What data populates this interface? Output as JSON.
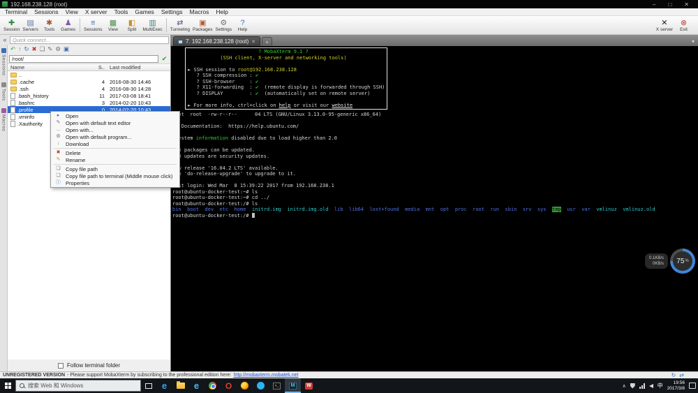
{
  "window": {
    "title": "192.168.238.128 (root)",
    "controls": [
      "minimize",
      "maximize",
      "close"
    ]
  },
  "menu": {
    "items": [
      "Terminal",
      "Sessions",
      "View",
      "X server",
      "Tools",
      "Games",
      "Settings",
      "Macros",
      "Help"
    ]
  },
  "toolbar": {
    "buttons": [
      {
        "label": "Session",
        "icon": "session-icon",
        "color": "#2f8c3f"
      },
      {
        "label": "Servers",
        "icon": "servers-icon",
        "color": "#5a78a8"
      },
      {
        "label": "Tools",
        "icon": "tools-icon",
        "color": "#a05a2c"
      },
      {
        "label": "Games",
        "icon": "games-icon",
        "color": "#7d5ba6"
      },
      {
        "label": "Sessions",
        "icon": "sessions-icon",
        "color": "#3b6fb5"
      },
      {
        "label": "View",
        "icon": "view-icon",
        "color": "#4a8f4a"
      },
      {
        "label": "Split",
        "icon": "split-icon",
        "color": "#c78f2e"
      },
      {
        "label": "MultiExec",
        "icon": "multiexec-icon",
        "color": "#3f7f7f"
      },
      {
        "label": "Tunneling",
        "icon": "tunneling-icon",
        "color": "#555588"
      },
      {
        "label": "Packages",
        "icon": "packages-icon",
        "color": "#b06030"
      },
      {
        "label": "Settings",
        "icon": "settings-icon",
        "color": "#707070"
      },
      {
        "label": "Help",
        "icon": "help-icon",
        "color": "#2e6fc0"
      }
    ],
    "right_buttons": [
      {
        "label": "X server",
        "icon": "xserver-icon",
        "color": "#222222"
      },
      {
        "label": "Exit",
        "icon": "exit-icon",
        "color": "#c23a2f"
      }
    ]
  },
  "quick_connect": {
    "placeholder": "Quick connect..."
  },
  "side_tabs": [
    {
      "label": "Sessions",
      "icon": "sessions-tab-icon",
      "color": "#3b6fb5"
    },
    {
      "label": "Tools",
      "icon": "tools-tab-icon",
      "color": "#8a8a8a"
    },
    {
      "label": "Macros",
      "icon": "macros-tab-icon",
      "color": "#a05aa0"
    }
  ],
  "file_panel": {
    "toolbar_icons": [
      {
        "name": "back-icon",
        "color": "#3f9d3f"
      },
      {
        "name": "up-icon",
        "color": "#3f9d3f"
      },
      {
        "name": "refresh-icon",
        "color": "#2e6fc0"
      },
      {
        "name": "stop-icon",
        "color": "#c23a2f"
      },
      {
        "name": "copy-icon",
        "color": "#707070"
      },
      {
        "name": "edit-icon",
        "color": "#707070"
      },
      {
        "name": "settings2-icon",
        "color": "#707070"
      },
      {
        "name": "monitor-icon",
        "color": "#3b6fb5"
      }
    ],
    "path": "/root/",
    "columns": {
      "name": "Name",
      "size": "S..",
      "modified": "Last modified"
    },
    "rows": [
      {
        "name": "..",
        "icon": "folder-up",
        "size": "",
        "modified": ""
      },
      {
        "name": ".cache",
        "icon": "folder",
        "size": "4",
        "modified": "2016-08-30 14:46"
      },
      {
        "name": ".ssh",
        "icon": "folder",
        "size": "4",
        "modified": "2016-08-30 14:28"
      },
      {
        "name": ".bash_history",
        "icon": "file",
        "size": "11",
        "modified": "2017-03-08 18:41"
      },
      {
        "name": ".bashrc",
        "icon": "file",
        "size": "3",
        "modified": "2014-02-20 10:43"
      },
      {
        "name": ".profile",
        "icon": "file",
        "size": "0",
        "modified": "2014-02-20 10:43",
        "selected": true
      },
      {
        "name": ".vminfo",
        "icon": "file",
        "size": "",
        "modified": ""
      },
      {
        "name": ".Xauthority",
        "icon": "file",
        "size": "",
        "modified": ""
      }
    ],
    "follow_label": "Follow terminal folder"
  },
  "context_menu": {
    "items": [
      {
        "label": "Open",
        "icon": "open-icon",
        "icon_color": "#3b6fb5"
      },
      {
        "label": "Open with default text editor",
        "icon": "editor-icon",
        "icon_color": "#707070"
      },
      {
        "label": "Open with...",
        "icon": "openwith-icon",
        "icon_color": "#707070"
      },
      {
        "label": "Open with default program...",
        "icon": "program-icon",
        "icon_color": "#707070"
      },
      {
        "label": "Download",
        "icon": "download-icon",
        "icon_color": "#3f9d3f"
      },
      {
        "separator": true
      },
      {
        "label": "Delete",
        "icon": "delete-icon",
        "icon_color": "#c23a2f"
      },
      {
        "label": "Rename",
        "icon": "rename-icon",
        "icon_color": "#c78f2e"
      },
      {
        "separator": true
      },
      {
        "label": "Copy file path",
        "icon": "copypath-icon",
        "icon_color": "#707070"
      },
      {
        "label": "Copy file path to terminal (Middle mouse click)",
        "icon": "copyterm-icon",
        "icon_color": "#707070"
      },
      {
        "label": "Properties",
        "icon": "properties-icon",
        "icon_color": "#2e6fc0"
      }
    ]
  },
  "terminal": {
    "tab_title": "7. 192.168.238.128 (root)",
    "banner": {
      "rows": [
        [
          {
            "t": "                        "
          },
          {
            "t": "? MobaXterm 9.1 ?",
            "c": "g"
          }
        ],
        [
          {
            "t": "           "
          },
          {
            "t": "(SSH client, X-server and networking tools)",
            "c": "y"
          }
        ],
        [],
        [
          {
            "t": "► SSH session to "
          },
          {
            "t": "root@192.168.238.128",
            "c": "y"
          }
        ],
        [
          {
            "t": "   ? SSH compression : "
          },
          {
            "t": "✔",
            "c": "g"
          }
        ],
        [
          {
            "t": "   ? SSH-browser     : "
          },
          {
            "t": "✔",
            "c": "g"
          }
        ],
        [
          {
            "t": "   ? X11-forwarding  : "
          },
          {
            "t": "✔",
            "c": "g"
          },
          {
            "t": "  (remote display is forwarded through SSH)"
          }
        ],
        [
          {
            "t": "   ? DISPLAY         : "
          },
          {
            "t": "✔",
            "c": "g"
          },
          {
            "t": "  (automatically set on remote server)"
          }
        ],
        [],
        [
          {
            "t": "► For more info, ctrl+click on "
          },
          {
            "t": "help",
            "c": "u"
          },
          {
            "t": " or visit our "
          },
          {
            "t": "website",
            "c": "u"
          }
        ]
      ]
    },
    "lines": [
      [
        {
          "t": "root  root  -rw-r--r--      04 LTS (GNU/Linux 3.13.0-95-generic x86_64)"
        }
      ],
      [],
      [
        {
          "t": " * Documentation:  https://help.ubuntu.com/"
        }
      ],
      [],
      [
        {
          "t": " System "
        },
        {
          "t": "information",
          "c": "g"
        },
        {
          "t": " disabled due to load higher than 2.0"
        }
      ],
      [],
      [
        {
          "t": "225 packages can be updated."
        }
      ],
      [
        {
          "t": "123 updates are security updates."
        }
      ],
      [],
      [
        {
          "t": "New release '16.04.2 LTS' available."
        }
      ],
      [
        {
          "t": "Run 'do-release-upgrade' to upgrade to it."
        }
      ],
      [],
      [
        {
          "t": "Last login: Wed Mar  8 15:39:22 2017 from 192.168.238.1"
        }
      ],
      [
        {
          "t": "root@ubuntu-docker-test:~# ls"
        }
      ],
      [
        {
          "t": "root@ubuntu-docker-test:~# cd ../"
        }
      ],
      [
        {
          "t": "root@ubuntu-docker-test:/# ls"
        }
      ],
      [
        {
          "t": "bin",
          "c": "b"
        },
        {
          "t": "  "
        },
        {
          "t": "boot",
          "c": "b"
        },
        {
          "t": "  "
        },
        {
          "t": "dev",
          "c": "b"
        },
        {
          "t": "  "
        },
        {
          "t": "etc",
          "c": "b"
        },
        {
          "t": "  "
        },
        {
          "t": "home",
          "c": "b"
        },
        {
          "t": "  "
        },
        {
          "t": "initrd.img",
          "c": "c"
        },
        {
          "t": "  "
        },
        {
          "t": "initrd.img.old",
          "c": "c"
        },
        {
          "t": "  "
        },
        {
          "t": "lib",
          "c": "b"
        },
        {
          "t": "  "
        },
        {
          "t": "lib64",
          "c": "b"
        },
        {
          "t": "  "
        },
        {
          "t": "lost+found",
          "c": "b"
        },
        {
          "t": "  "
        },
        {
          "t": "media",
          "c": "b"
        },
        {
          "t": "  "
        },
        {
          "t": "mnt",
          "c": "b"
        },
        {
          "t": "  "
        },
        {
          "t": "opt",
          "c": "b"
        },
        {
          "t": "  "
        },
        {
          "t": "proc",
          "c": "b"
        },
        {
          "t": "  "
        },
        {
          "t": "root",
          "c": "b"
        },
        {
          "t": "  "
        },
        {
          "t": "run",
          "c": "b"
        },
        {
          "t": "  "
        },
        {
          "t": "sbin",
          "c": "b"
        },
        {
          "t": "  "
        },
        {
          "t": "srv",
          "c": "b"
        },
        {
          "t": "  "
        },
        {
          "t": "sys",
          "c": "b"
        },
        {
          "t": "  "
        },
        {
          "t": "tmp",
          "c": "tmp"
        },
        {
          "t": "  "
        },
        {
          "t": "usr",
          "c": "b"
        },
        {
          "t": "  "
        },
        {
          "t": "var",
          "c": "b"
        },
        {
          "t": "  "
        },
        {
          "t": "vmlinuz",
          "c": "c"
        },
        {
          "t": "  "
        },
        {
          "t": "vmlinuz.old",
          "c": "c"
        }
      ],
      [
        {
          "t": "root@ubuntu-docker-test:/# "
        },
        {
          "cursor": true
        }
      ]
    ]
  },
  "net_widget": {
    "up": "0.1KB/s",
    "down": "0KB/s",
    "percent": "75",
    "unit": "%"
  },
  "status_bar": {
    "bold": "UNREGISTERED VERSION",
    "text": "- Please support MobaXterm by subscribing to the professional edition here:",
    "link": "http://mobaxterm.mobatek.net"
  },
  "taskbar": {
    "search_placeholder": "搜索 Web 和 Windows",
    "apps": [
      {
        "name": "edge"
      },
      {
        "name": "explorer"
      },
      {
        "name": "ie"
      },
      {
        "name": "chrome"
      },
      {
        "name": "opera"
      },
      {
        "name": "firefox"
      },
      {
        "name": "messenger"
      },
      {
        "name": "cmd"
      },
      {
        "name": "mobaxterm",
        "active": true
      },
      {
        "name": "wps"
      }
    ],
    "tray": {
      "lang": "中",
      "time": "19:56",
      "date": "2017/3/8"
    }
  }
}
